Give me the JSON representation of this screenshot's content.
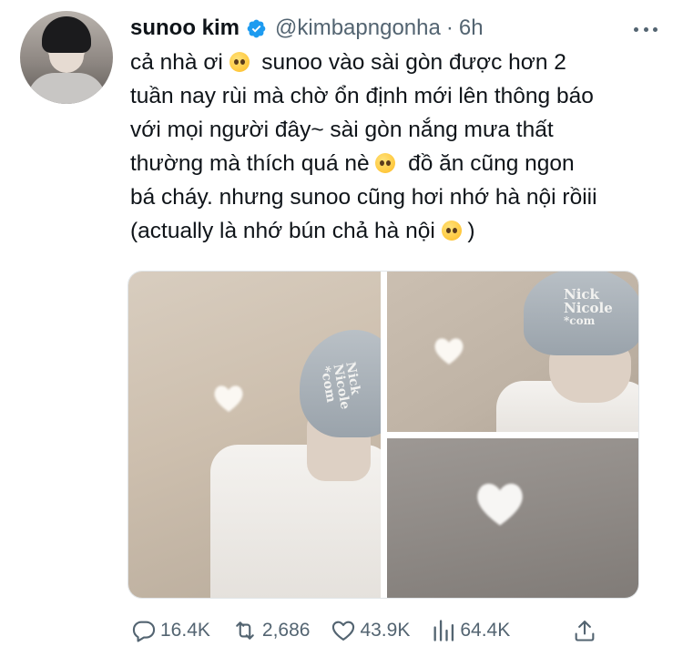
{
  "author": {
    "name": "sunoo kim",
    "handle": "@kimbapngonha",
    "separator": "·",
    "time": "6h",
    "verified": true
  },
  "tweet": {
    "lines": [
      [
        "cả nhà ơi ",
        "pleading-face-emoji",
        "  sunoo vào sài gòn được hơn 2"
      ],
      [
        "tuần nay rùi mà chờ ổn định mới lên thông báo"
      ],
      [
        "với mọi người đây~ sài gòn nắng mưa thất"
      ],
      [
        "thường mà thích quá nè ",
        "pleading-face-emoji",
        "  đồ ăn cũng ngon"
      ],
      [
        "bá cháy. nhưng sunoo cũng hơi nhớ hà nội rồiii"
      ],
      [
        "(actually là nhớ bún chả hà nội ",
        "smiling-face-emoji",
        " )"
      ]
    ]
  },
  "media": {
    "photos": [
      {
        "cap_text": [
          "Nick",
          "Nicole",
          "*com"
        ]
      },
      {
        "cap_text": [
          "Nick",
          "Nicole",
          "*com"
        ]
      },
      {
        "cap_text": []
      }
    ]
  },
  "actions": {
    "replies": "16.4K",
    "retweets": "2,686",
    "likes": "43.9K",
    "views": "64.4K"
  },
  "icons": {
    "verified": "verified-badge-icon",
    "more": "more-options-icon",
    "reply": "reply-icon",
    "retweet": "retweet-icon",
    "like": "like-icon",
    "views": "views-icon",
    "share": "share-icon"
  },
  "colors": {
    "verified": "#1d9bf0",
    "secondary_text": "#536471",
    "primary_text": "#0f1419"
  }
}
